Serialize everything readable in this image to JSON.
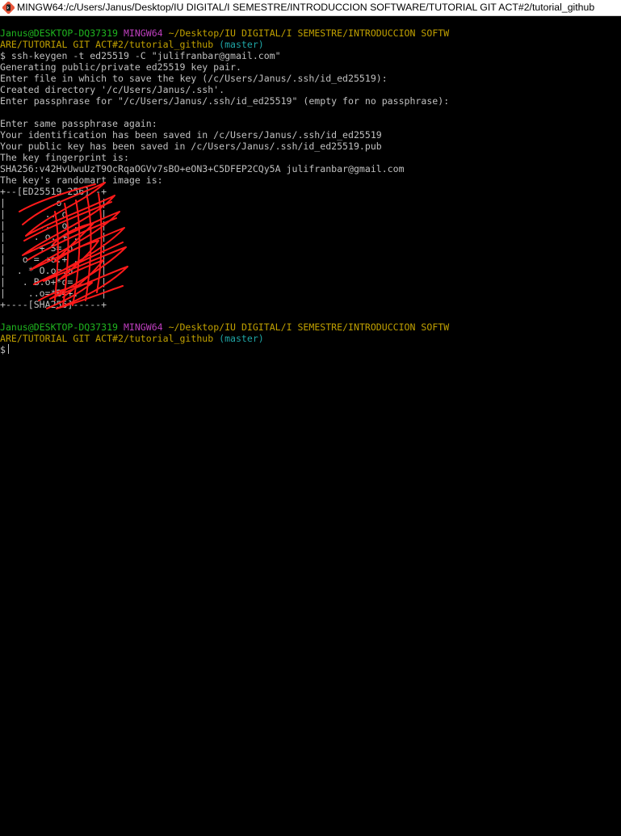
{
  "window": {
    "title": "MINGW64:/c/Users/Janus/Desktop/IU DIGITAL/I SEMESTRE/INTRODUCCION SOFTWARE/TUTORIAL GIT ACT#2/tutorial_github",
    "icon": "git-bash-icon"
  },
  "colors": {
    "background": "#000000",
    "text": "#c0c0c0",
    "user_host": "#1fb51f",
    "shell_name": "#bf3fbf",
    "path": "#c0a000",
    "branch": "#1fa5a5",
    "redaction": "#ff0000"
  },
  "prompt1": {
    "user_host": "Janus@DESKTOP-DQ37319",
    "shell": "MINGW64",
    "path_part1": "~/Desktop/IU DIGITAL/I SEMESTRE/INTRODUCCION SOFTW",
    "path_part2": "ARE/TUTORIAL GIT ACT#2/tutorial_github",
    "branch": "(master)"
  },
  "output": {
    "command": "$ ssh-keygen -t ed25519 -C \"julifranbar@gmail.com\"",
    "line_generating": "Generating public/private ed25519 key pair.",
    "line_enter_file": "Enter file in which to save the key (/c/Users/Janus/.ssh/id_ed25519):",
    "line_created_dir": "Created directory '/c/Users/Janus/.ssh'.",
    "line_passphrase": "Enter passphrase for \"/c/Users/Janus/.ssh/id_ed25519\" (empty for no passphrase):",
    "line_passphrase_again": "Enter same passphrase again:",
    "line_identification": "Your identification has been saved in /c/Users/Janus/.ssh/id_ed25519",
    "line_public_key": "Your public key has been saved in /c/Users/Janus/.ssh/id_ed25519.pub",
    "line_fingerprint_label": "The key fingerprint is:",
    "line_fingerprint": "SHA256:v42HvUwuUzT9OcRqaOGVv7sBO+eON3+C5DFEP2CQy5A julifranbar@gmail.com",
    "line_randomart_label": "The key's randomart image is:",
    "randomart_top": "+--[ED25519 256]--+",
    "randomart_rows": [
      "|        .o       |",
      "|       .. o      |",
      "|      ..  o .    |",
      "|     . o. + .    |",
      "|    . + S= o     |",
      "|   o = +o.+ .    |",
      "|  . * O.o=.o     |",
      "|   . B.o+*o=     |",
      "|    ..o=*B=+.    |"
    ],
    "randomart_bottom": "+----[SHA256]-----+"
  },
  "prompt2": {
    "user_host": "Janus@DESKTOP-DQ37319",
    "shell": "MINGW64",
    "path_part1": "~/Desktop/IU DIGITAL/I SEMESTRE/INTRODUCCION SOFTW",
    "path_part2": "ARE/TUTORIAL GIT ACT#2/tutorial_github",
    "branch": "(master)",
    "prompt_symbol": "$"
  }
}
